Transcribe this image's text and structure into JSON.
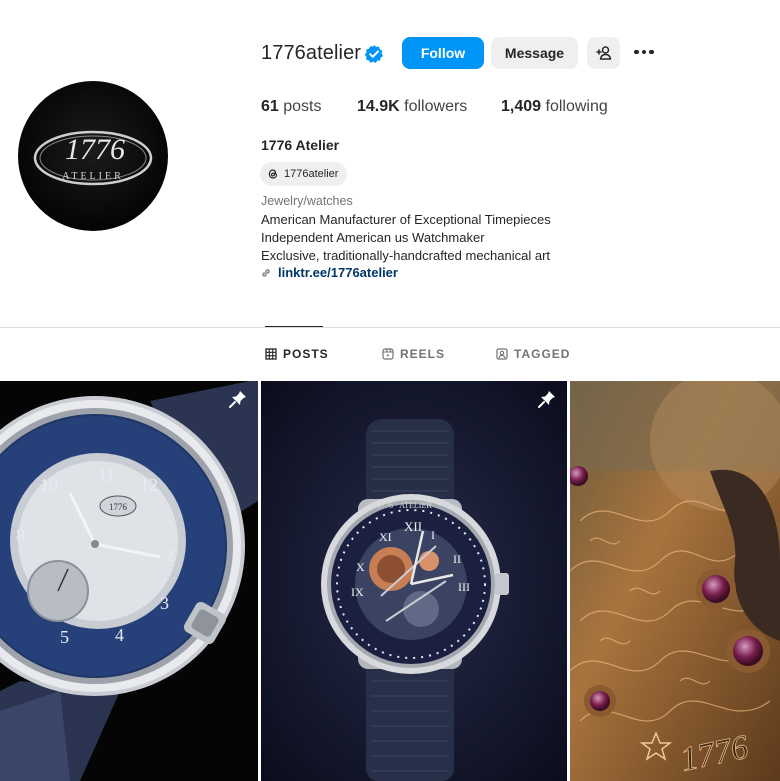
{
  "profile": {
    "username": "1776atelier",
    "full_name": "1776 Atelier",
    "avatar_logo": {
      "number": "1776",
      "word": "ATELIER"
    },
    "verified": true,
    "follow_label": "Follow",
    "message_label": "Message",
    "add_user_icon": "person-add-icon",
    "more_icon": "more-options-icon"
  },
  "stats": {
    "posts_count": "61",
    "posts_label": "posts",
    "followers_count": "14.9K",
    "followers_label": "followers",
    "following_count": "1,409",
    "following_label": "following"
  },
  "bio": {
    "threads_handle": "1776atelier",
    "category": "Jewelry/watches",
    "lines": [
      "American Manufacturer of Exceptional Timepieces",
      "Independent American us Watchmaker",
      "Exclusive, traditionally-handcrafted mechanical art"
    ],
    "link": "linktr.ee/1776atelier"
  },
  "tabs": [
    {
      "label": "POSTS",
      "icon": "grid-icon",
      "active": true
    },
    {
      "label": "REELS",
      "icon": "reels-icon",
      "active": false
    },
    {
      "label": "TAGGED",
      "icon": "tagged-icon",
      "active": false
    }
  ],
  "posts": [
    {
      "subject": "blue dial watch",
      "pinned": true
    },
    {
      "subject": "skeleton watch",
      "pinned": true
    },
    {
      "subject": "engraved movement macro",
      "pinned": false
    }
  ],
  "colors": {
    "accent": "#0095f6",
    "verified": "#0095f6",
    "link": "#00376b",
    "secondary_text": "#737373",
    "button_gray": "#efefef"
  }
}
